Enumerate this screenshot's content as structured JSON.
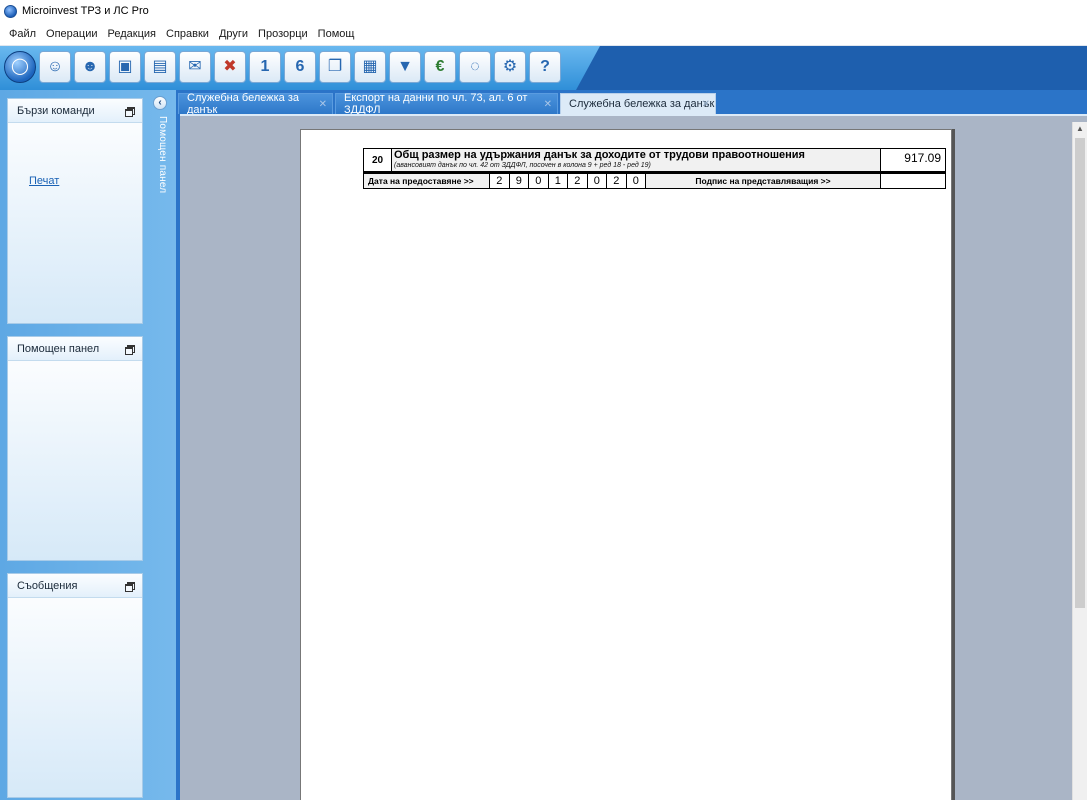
{
  "app": {
    "title": "Microinvest ТРЗ и ЛС Pro"
  },
  "menu": [
    "Файл",
    "Операции",
    "Редакция",
    "Справки",
    "Други",
    "Прозорци",
    "Помощ"
  ],
  "toolbar": {
    "buttons": [
      {
        "icon": "globe-icon"
      },
      {
        "icon": "users-icon"
      },
      {
        "icon": "group-icon"
      },
      {
        "icon": "employee-card-icon"
      },
      {
        "icon": "employees-list-icon"
      },
      {
        "icon": "payroll-envelope-icon"
      },
      {
        "icon": "cancel-envelope-icon"
      },
      {
        "icon": "document-1-icon"
      },
      {
        "icon": "document-6-icon"
      },
      {
        "icon": "documents-icon"
      },
      {
        "icon": "person-document-icon"
      },
      {
        "icon": "download-icon"
      },
      {
        "icon": "euro-icon"
      },
      {
        "icon": "chat-icon"
      },
      {
        "icon": "settings-icon"
      },
      {
        "icon": "help-icon"
      }
    ]
  },
  "panels": {
    "quick": {
      "title": "Бързи команди",
      "link": "Печат"
    },
    "help": {
      "title": "Помощен панел"
    },
    "messages": {
      "title": "Съобщения"
    },
    "side_label": "Помощен панел"
  },
  "tabs": [
    {
      "label": "Служебна бележка за данък",
      "active": false
    },
    {
      "label": "Експорт на данни по чл. 73, ал. 6 от ЗДДФЛ",
      "active": false
    },
    {
      "label": "Служебна бележка за данък",
      "active": true
    }
  ],
  "form": {
    "row_number": "20",
    "row_title": "Общ размер на удържания данък за доходите от трудови правоотношения",
    "row_note": "(авансовият данък по чл. 42 от ЗДДФЛ, посочен в колона 9 + ред 18 - ред 19)",
    "row_value": "917.09",
    "date_label": "Дата на предоставяне >>",
    "date_digits": [
      "2",
      "9",
      "0",
      "1",
      "2",
      "0",
      "2",
      "0"
    ],
    "signature_label": "Подпис на представляващия  >>"
  }
}
